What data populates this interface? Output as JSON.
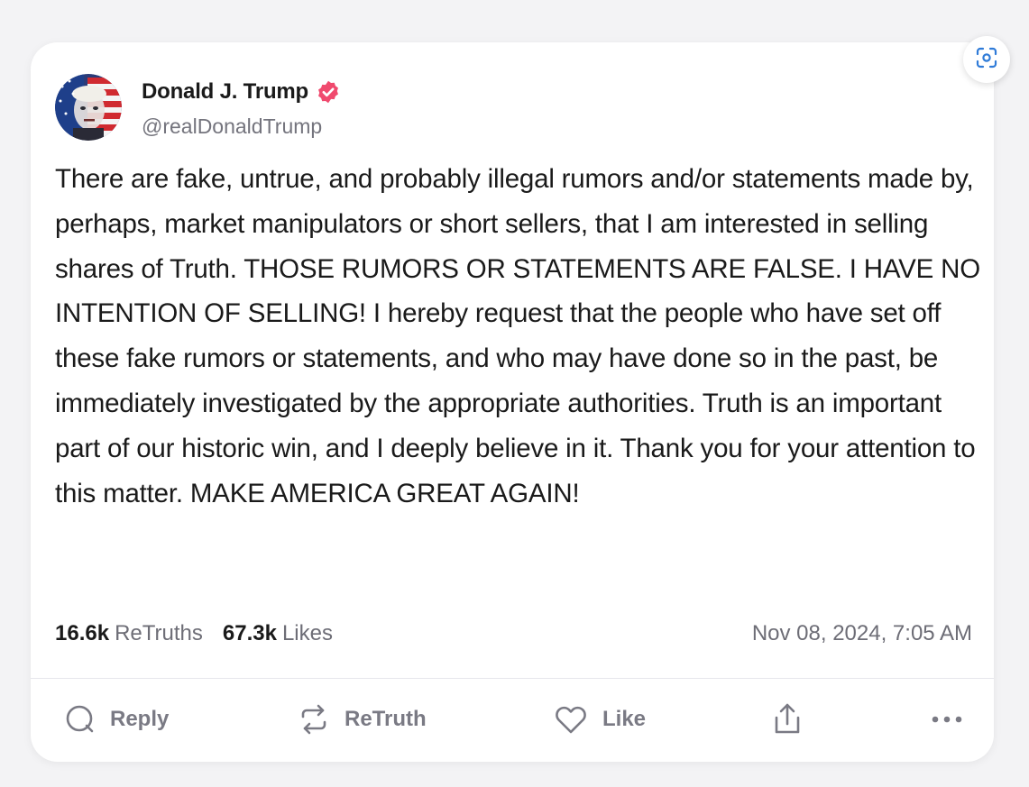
{
  "post": {
    "author": {
      "display_name": "Donald J. Trump",
      "handle": "@realDonaldTrump",
      "verified": true,
      "verified_color": "#f04a6e"
    },
    "text": "There are fake, untrue, and probably illegal rumors and/or statements made by, perhaps, market manipulators or short sellers, that I am interested in selling shares of Truth. THOSE RUMORS OR STATEMENTS ARE FALSE. I HAVE NO INTENTION OF SELLING! I hereby request that the people who have set off these fake rumors or statements, and who may have done so in the past, be immediately investigated by the appropriate authorities. Truth is an important part of our historic win, and I deeply believe in it. Thank you for your attention to this matter. MAKE AMERICA GREAT AGAIN!",
    "stats": {
      "retruths_count": "16.6k",
      "retruths_label": "ReTruths",
      "likes_count": "67.3k",
      "likes_label": "Likes"
    },
    "timestamp": "Nov 08, 2024, 7:05 AM"
  },
  "actions": {
    "reply_label": "Reply",
    "retruth_label": "ReTruth",
    "like_label": "Like",
    "share_icon": "share-icon",
    "more_icon": "more-icon"
  },
  "overlay": {
    "lens_icon": "visual-search-icon"
  },
  "colors": {
    "action_gray": "#7a7a84",
    "text_dark": "#1a1a1a",
    "muted": "#6d6d76",
    "accent_blue": "#2f7bd8"
  }
}
